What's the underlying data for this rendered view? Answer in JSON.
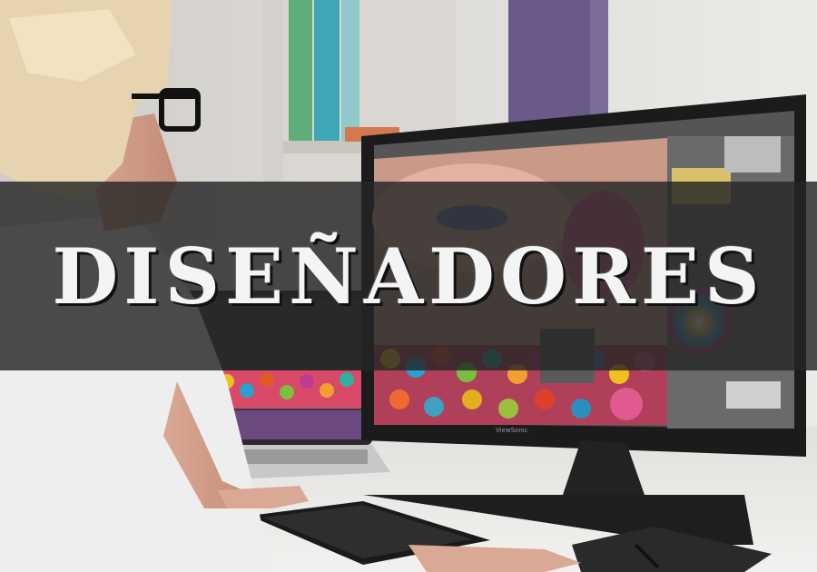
{
  "banner": {
    "title": "DISEÑADORES"
  },
  "monitor": {
    "brand": "ViewSonic"
  },
  "colors": {
    "banner_overlay": "#262626",
    "title_text": "#f4f4f4",
    "monitor_bezel": "#1b1b1b",
    "wall": "#e7e5e1"
  }
}
